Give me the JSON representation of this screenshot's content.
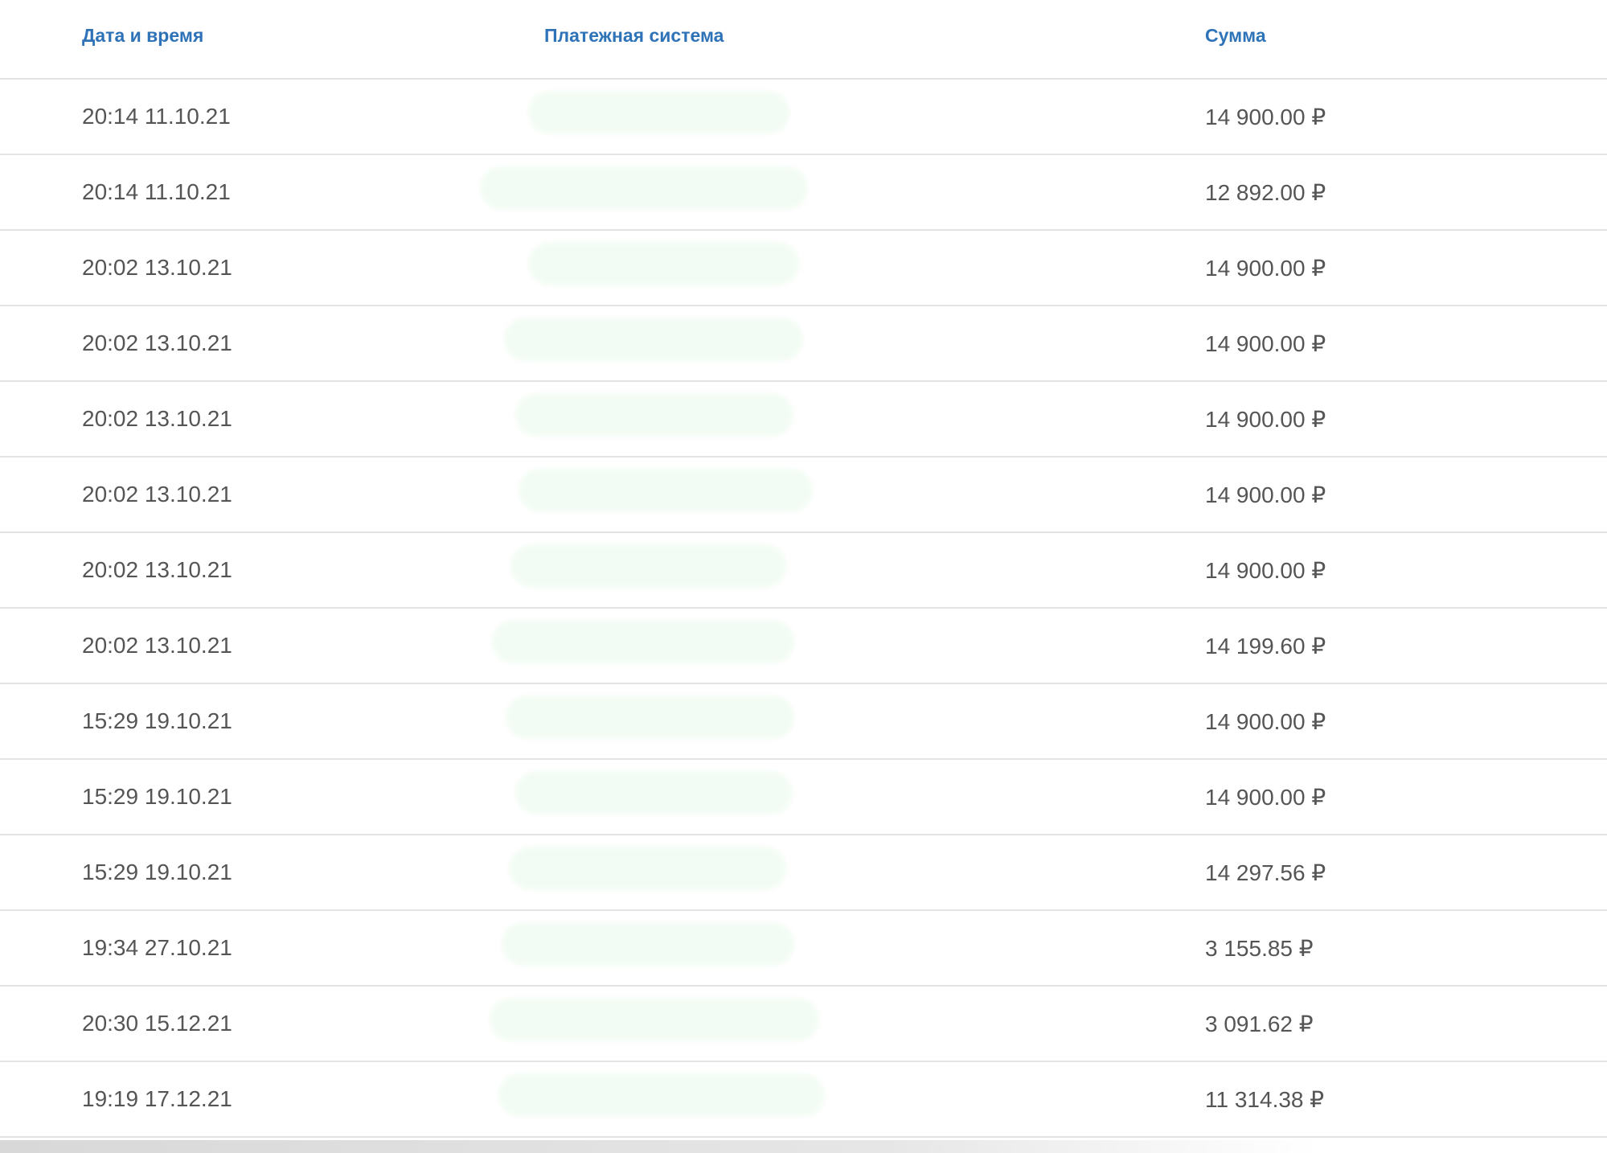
{
  "table": {
    "headers": {
      "date": "Дата и время",
      "payment_system": "Платежная система",
      "amount": "Сумма"
    },
    "rows": [
      {
        "date": "20:14 11.10.21",
        "payment_system": "",
        "amount": "14 900.00 ₽"
      },
      {
        "date": "20:14 11.10.21",
        "payment_system": "",
        "amount": "12 892.00 ₽"
      },
      {
        "date": "20:02 13.10.21",
        "payment_system": "",
        "amount": "14 900.00 ₽"
      },
      {
        "date": "20:02 13.10.21",
        "payment_system": "",
        "amount": "14 900.00 ₽"
      },
      {
        "date": "20:02 13.10.21",
        "payment_system": "",
        "amount": "14 900.00 ₽"
      },
      {
        "date": "20:02 13.10.21",
        "payment_system": "",
        "amount": "14 900.00 ₽"
      },
      {
        "date": "20:02 13.10.21",
        "payment_system": "",
        "amount": "14 900.00 ₽"
      },
      {
        "date": "20:02 13.10.21",
        "payment_system": "",
        "amount": "14 199.60 ₽"
      },
      {
        "date": "15:29 19.10.21",
        "payment_system": "",
        "amount": "14 900.00 ₽"
      },
      {
        "date": "15:29 19.10.21",
        "payment_system": "",
        "amount": "14 900.00 ₽"
      },
      {
        "date": "15:29 19.10.21",
        "payment_system": "",
        "amount": "14 297.56 ₽"
      },
      {
        "date": "19:34 27.10.21",
        "payment_system": "",
        "amount": "3 155.85 ₽"
      },
      {
        "date": "20:30 15.12.21",
        "payment_system": "",
        "amount": "3 091.62 ₽"
      },
      {
        "date": "19:19 17.12.21",
        "payment_system": "",
        "amount": "11 314.38 ₽"
      }
    ]
  },
  "colors": {
    "header_text": "#2e73b8",
    "cell_text": "#555555",
    "divider": "#e3e3e3",
    "redacted_fill": "#f3fcf4"
  }
}
